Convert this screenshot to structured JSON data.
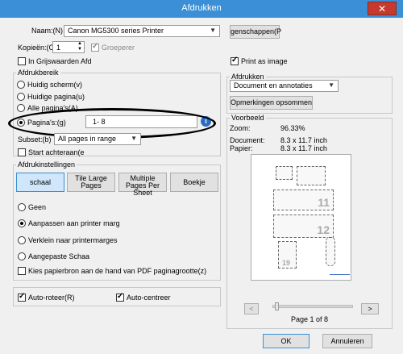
{
  "window": {
    "title": "Afdrukken",
    "close_glyph": "✕"
  },
  "printer": {
    "name_label": "Naam:(N)",
    "name_value": "Canon MG5300 series Printer",
    "properties_button": "genschappen(P",
    "copies_label": "Kopieën:(C",
    "copies_value": "1",
    "collate_label": "Groeperer",
    "grayscale_label": "In Grijswaarden Afd",
    "print_as_image_label": "Print as image"
  },
  "range": {
    "title": "Afdrukbereik",
    "options": [
      "Huidig scherm(v)",
      "Huidige pagina(u)",
      "Alle pagina's(A)",
      "Pagina's:(g)"
    ],
    "pages_value": "1- 8",
    "info_glyph": "i",
    "subset_label": "Subset:(b)",
    "subset_value": "All pages in range",
    "reverse_label": "Start achteraan(e"
  },
  "print_what": {
    "title": "Afdrukken",
    "value": "Document en annotaties",
    "summarize_button": "Opmerkingen opsommen"
  },
  "preview": {
    "title": "Voorbeeld",
    "zoom_label": "Zoom:",
    "zoom_value": "96.33%",
    "doc_label": "Document:",
    "doc_value": "8.3 x 11.7 inch",
    "paper_label": "Papier:",
    "paper_value": "8.3 x 11.7 inch",
    "page_indicator": "Page 1 of 8",
    "prev_glyph": "<",
    "next_glyph": ">",
    "stamp_numbers": [
      "11",
      "12",
      "19"
    ]
  },
  "settings": {
    "title": "Afdrukinstellingen",
    "tabs": [
      "schaal",
      "Tile Large Pages",
      "Multiple Pages Per Sheet",
      "Boekje"
    ],
    "scale_options": [
      "Geen",
      "Aanpassen aan printer marg",
      "Verklein naar printermarges",
      "Aangepaste Schaa"
    ],
    "paper_source_label": "Kies papierbron aan de hand van PDF paginagrootte(z)"
  },
  "bottom": {
    "auto_rotate": "Auto-roteer(R)",
    "auto_center": "Auto-centreer",
    "ok": "OK",
    "cancel": "Annuleren"
  },
  "colors": {
    "title_bar": "#3a8fd6",
    "close_button": "#c7392d",
    "tab_selected": "#cfe6fb"
  },
  "icons": [
    "close-icon",
    "dropdown-arrow-icon",
    "info-icon",
    "spinner-icon",
    "radio-icon",
    "checkbox-icon"
  ]
}
